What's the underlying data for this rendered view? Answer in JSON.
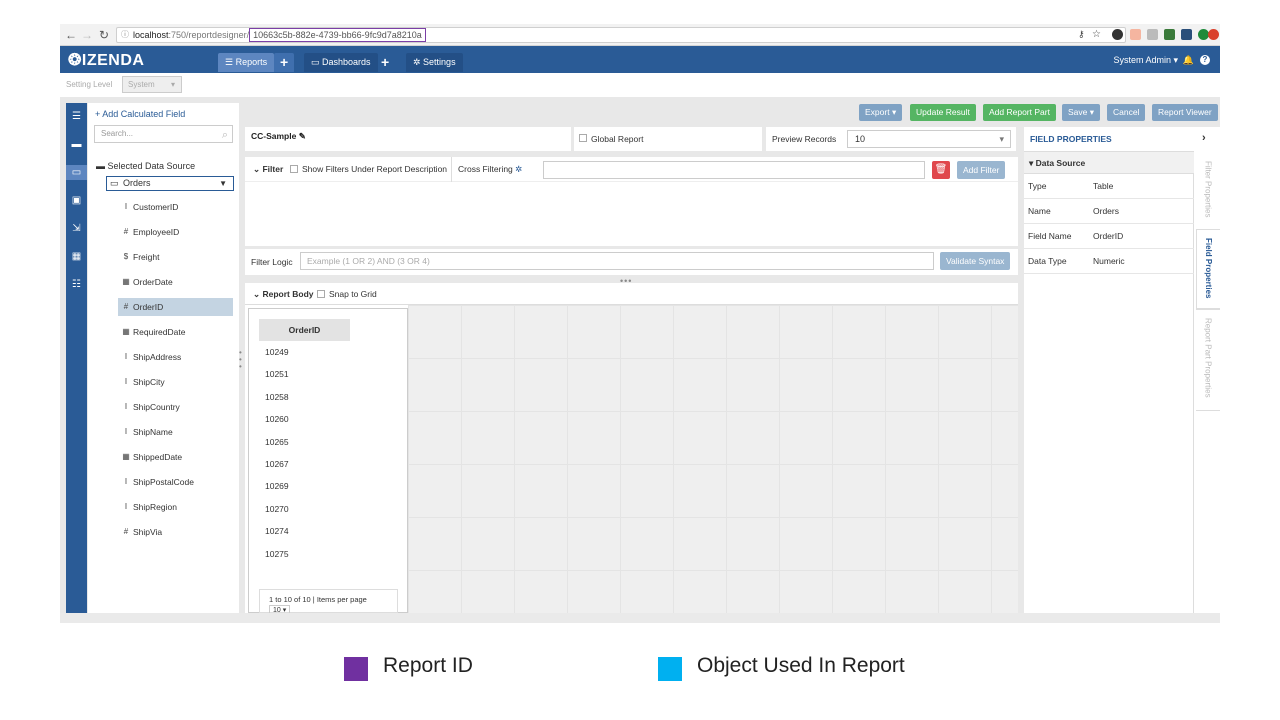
{
  "browser": {
    "url_host": "localhost",
    "url_path": ":750/reportdesigner/",
    "report_id": "10663c5b-882e-4739-bb66-9fc9d7a8210a"
  },
  "header": {
    "logo": "IZENDA",
    "nav": {
      "reports": "Reports",
      "dashboards": "Dashboards",
      "settings": "Settings"
    },
    "user": "System Admin"
  },
  "setting_level": {
    "label": "Setting Level",
    "value": "System"
  },
  "toolbar": {
    "export": "Export",
    "update_result": "Update Result",
    "add_report_part": "Add Report Part",
    "save": "Save",
    "cancel": "Cancel",
    "report_viewer": "Report Viewer"
  },
  "fields_panel": {
    "add_calculated": "Add Calculated Field",
    "search_placeholder": "Search...",
    "selected_source_label": "Selected Data Source",
    "source": "Orders",
    "fields": [
      {
        "name": "CustomerID",
        "type": "I"
      },
      {
        "name": "EmployeeID",
        "type": "#"
      },
      {
        "name": "Freight",
        "type": "$"
      },
      {
        "name": "OrderDate",
        "type": "▦"
      },
      {
        "name": "OrderID",
        "type": "#"
      },
      {
        "name": "RequiredDate",
        "type": "▦"
      },
      {
        "name": "ShipAddress",
        "type": "I"
      },
      {
        "name": "ShipCity",
        "type": "I"
      },
      {
        "name": "ShipCountry",
        "type": "I"
      },
      {
        "name": "ShipName",
        "type": "I"
      },
      {
        "name": "ShippedDate",
        "type": "▦"
      },
      {
        "name": "ShipPostalCode",
        "type": "I"
      },
      {
        "name": "ShipRegion",
        "type": "I"
      },
      {
        "name": "ShipVia",
        "type": "#"
      }
    ]
  },
  "report": {
    "title": "CC-Sample",
    "global_label": "Global Report",
    "preview_label": "Preview Records",
    "preview_value": "10"
  },
  "filter": {
    "label": "Filter",
    "show_under_desc": "Show Filters Under Report Description",
    "cross_filtering": "Cross Filtering",
    "add_filter": "Add Filter",
    "logic_label": "Filter Logic",
    "logic_placeholder": "Example (1 OR 2) AND (3 OR 4)",
    "validate": "Validate Syntax"
  },
  "body": {
    "label": "Report Body",
    "snap": "Snap to Grid",
    "column": "OrderID",
    "rows": [
      "10249",
      "10251",
      "10258",
      "10260",
      "10265",
      "10267",
      "10269",
      "10270",
      "10274",
      "10275"
    ],
    "pager": "1 to 10 of 10 | Items per page",
    "pager_value": "10"
  },
  "properties": {
    "title": "FIELD PROPERTIES",
    "section": "Data Source",
    "rows": [
      {
        "key": "Type",
        "value": "Table"
      },
      {
        "key": "Name",
        "value": "Orders"
      },
      {
        "key": "Field Name",
        "value": "OrderID"
      },
      {
        "key": "Data Type",
        "value": "Numeric"
      }
    ],
    "tabs": [
      "Filter Properties",
      "Field Properties",
      "Report Part Properties"
    ]
  },
  "legend": [
    {
      "label": "Report ID",
      "color": "#7030a0"
    },
    {
      "label": "Object Used In Report",
      "color": "#00b0f0"
    }
  ]
}
